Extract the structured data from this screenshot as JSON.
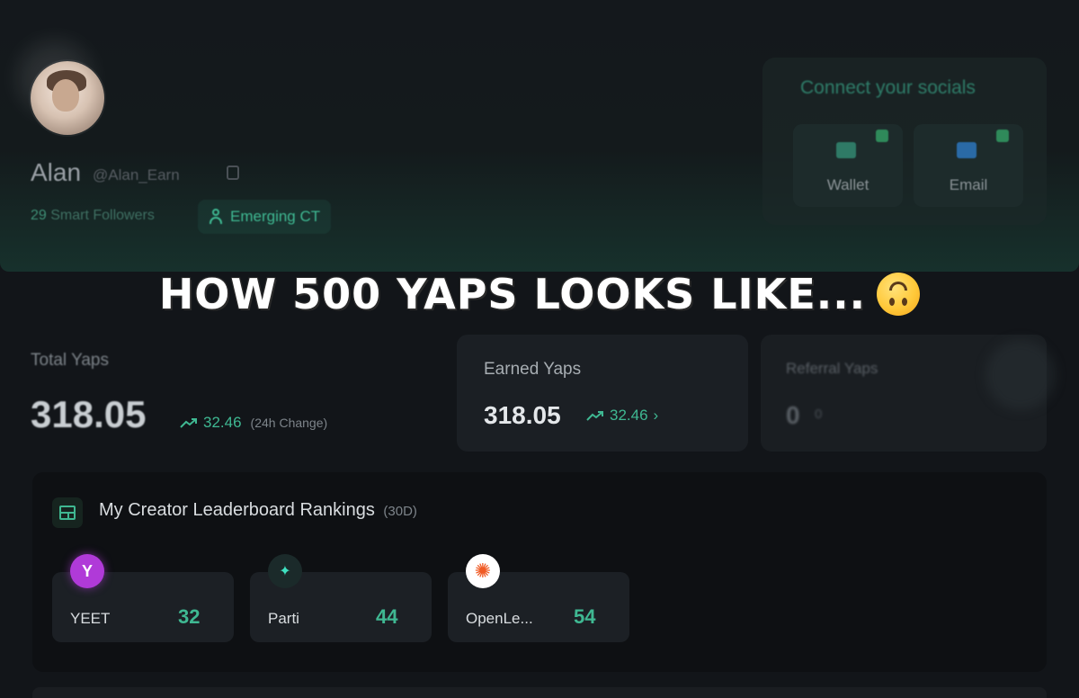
{
  "profile": {
    "name": "Alan",
    "handle": "@Alan_Earn",
    "smart_followers_count": "29",
    "smart_followers_label": "Smart Followers",
    "badge": "Emerging CT"
  },
  "socials": {
    "title": "Connect your socials",
    "items": [
      {
        "label": "Wallet",
        "icon": "wallet-icon"
      },
      {
        "label": "Email",
        "icon": "mail-icon"
      }
    ]
  },
  "caption": {
    "text": "HOW 500 YAPS LOOKS LIKE...",
    "emoji": "upside-down-face"
  },
  "stats": {
    "total": {
      "label": "Total Yaps",
      "value": "318.05",
      "change": "32.46",
      "change_period": "(24h Change)"
    },
    "earned": {
      "label": "Earned Yaps",
      "value": "318.05",
      "change": "32.46",
      "chevron": "›"
    },
    "referral": {
      "label": "Referral Yaps",
      "value": "0",
      "change": "0"
    }
  },
  "leaderboard": {
    "title": "My Creator Leaderboard Rankings",
    "period": "(30D)",
    "rankings": [
      {
        "name": "YEET",
        "rank": "32",
        "logo_color": "#b03ad8",
        "logo_glyph": "Y"
      },
      {
        "name": "Parti",
        "rank": "44",
        "logo_color": "#1b2a2a",
        "logo_glyph": "✦"
      },
      {
        "name": "OpenLe...",
        "rank": "54",
        "logo_color": "#f05a24",
        "logo_glyph": "✺"
      }
    ]
  },
  "colors": {
    "accent": "#3fb892",
    "background": "#121519",
    "card": "#1b1f24"
  }
}
